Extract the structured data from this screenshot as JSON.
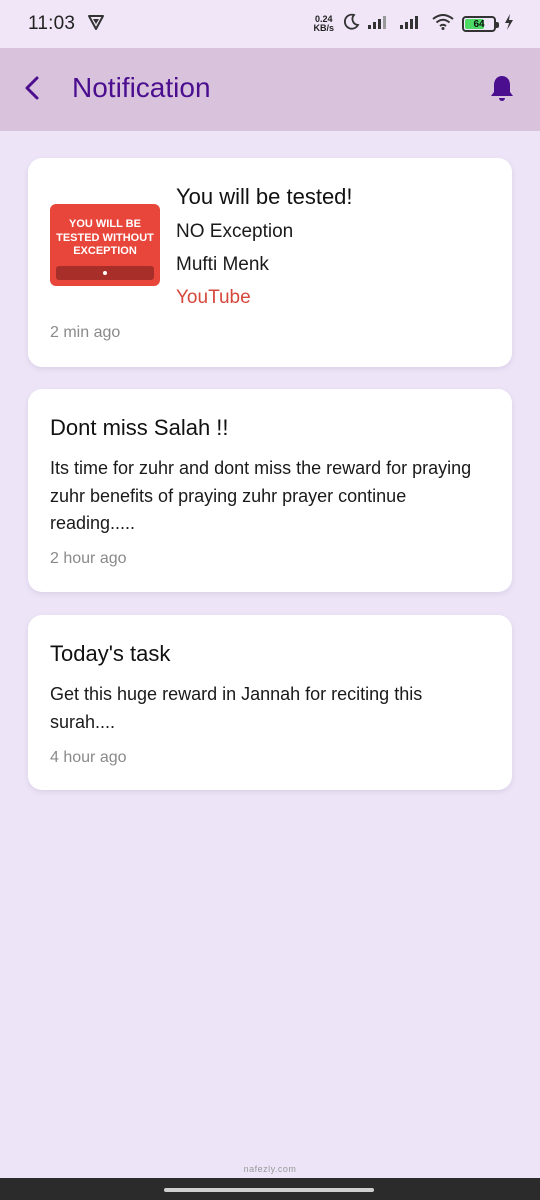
{
  "status_bar": {
    "time": "11:03",
    "net_speed_value": "0.24",
    "net_speed_unit": "KB/s",
    "battery": "64",
    "icons": [
      "vpn-shield-icon",
      "moon-icon",
      "signal-icon",
      "signal-icon",
      "wifi-icon",
      "battery-icon",
      "charging-icon"
    ]
  },
  "app_bar": {
    "title": "Notification",
    "back_icon": "chevron-left-icon",
    "bell_icon": "bell-icon",
    "accent_color": "#4a0e8f"
  },
  "notifications": [
    {
      "thumbnail_text": "YOU WILL BE TESTED WITHOUT EXCEPTION",
      "title": "You will be tested!",
      "line1": "NO Exception",
      "line2": "Mufti Menk",
      "source": "YouTube",
      "time": "2 min ago"
    },
    {
      "title": "Dont miss Salah !!",
      "body": "Its time for zuhr and dont miss the reward for praying zuhr benefits of praying zuhr prayer continue reading.....",
      "time": "2 hour ago"
    },
    {
      "title": "Today's task",
      "body": "Get this huge reward in Jannah for reciting this surah....",
      "time": "4 hour ago"
    }
  ],
  "watermark": "nafezly.com",
  "colors": {
    "background": "#ede5f7",
    "app_bar": "#d9c3dc",
    "source_link": "#d6473c",
    "timestamp": "#8a8a8a"
  }
}
